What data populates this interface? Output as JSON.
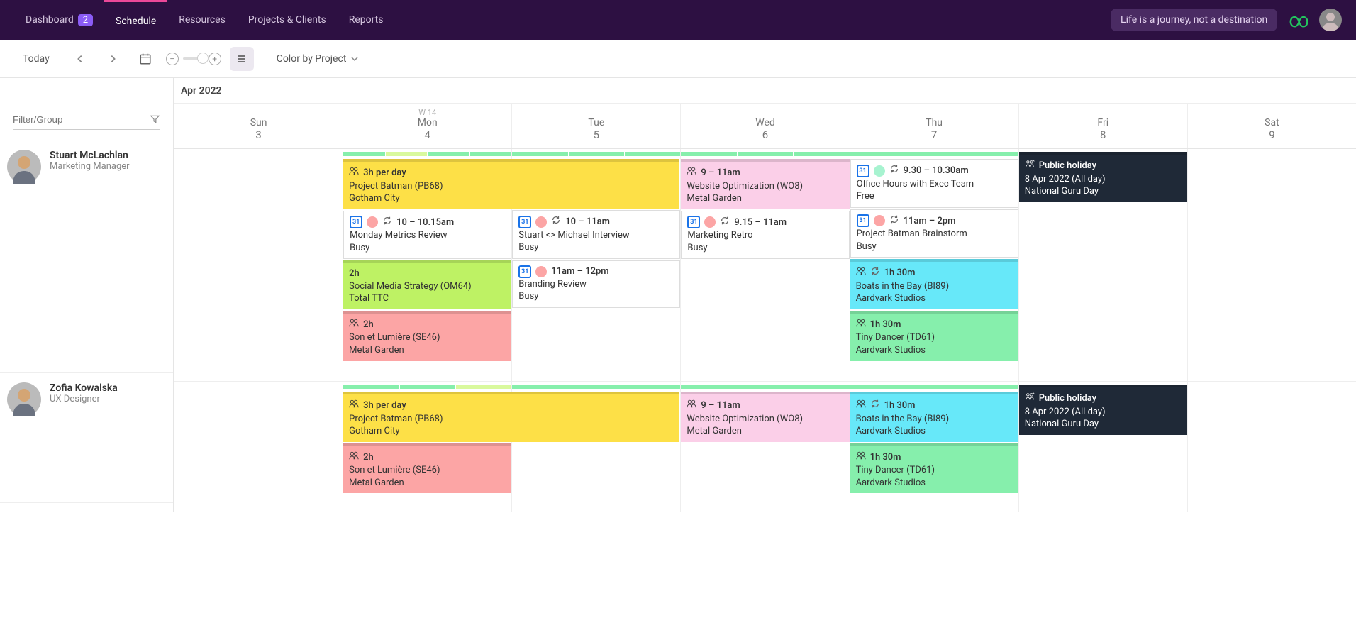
{
  "nav": {
    "items": [
      {
        "label": "Dashboard",
        "badge": "2"
      },
      {
        "label": "Schedule"
      },
      {
        "label": "Resources"
      },
      {
        "label": "Projects & Clients"
      },
      {
        "label": "Reports"
      }
    ],
    "quote": "Life is a journey, not a destination"
  },
  "toolbar": {
    "today": "Today",
    "colorby": "Color by Project",
    "month": "Apr 2022"
  },
  "filter": {
    "placeholder": "Filter/Group"
  },
  "days": [
    {
      "wk": "",
      "d": "Sun",
      "n": "3"
    },
    {
      "wk": "W 14",
      "d": "Mon",
      "n": "4"
    },
    {
      "wk": "",
      "d": "Tue",
      "n": "5"
    },
    {
      "wk": "",
      "d": "Wed",
      "n": "6"
    },
    {
      "wk": "",
      "d": "Thu",
      "n": "7"
    },
    {
      "wk": "",
      "d": "Fri",
      "n": "8"
    },
    {
      "wk": "",
      "d": "Sat",
      "n": "9"
    }
  ],
  "people": [
    {
      "name": "Stuart McLachlan",
      "role": "Marketing Manager"
    },
    {
      "name": "Zofia Kowalska",
      "role": "UX Designer"
    }
  ],
  "row1": {
    "mon": [
      {
        "cls": "c-yellow",
        "icon": "people",
        "dur": "3h per day",
        "title": "Project Batman (PB68)",
        "sub": "Gotham City",
        "spanto": "tue"
      },
      {
        "cls": "c-white",
        "gcal": true,
        "dot": "#fca5a5",
        "recur": true,
        "time": "10 – 10.15am",
        "title": "Monday Metrics Review",
        "sub": "Busy"
      },
      {
        "cls": "c-lime",
        "dur": "2h",
        "title": "Social Media Strategy (OM64)",
        "sub": "Total TTC"
      },
      {
        "cls": "c-salmon",
        "icon": "people",
        "dur": "2h",
        "title": "Son et Lumière (SE46)",
        "sub": "Metal Garden"
      }
    ],
    "tue": [
      {
        "cls": "c-white",
        "gcal": true,
        "dot": "#fca5a5",
        "recur": true,
        "time": "10 – 11am",
        "title": "Stuart <> Michael Interview",
        "sub": "Busy"
      },
      {
        "cls": "c-white",
        "gcal": true,
        "dot": "#fca5a5",
        "time": "11am – 12pm",
        "title": "Branding Review",
        "sub": "Busy"
      }
    ],
    "wed": [
      {
        "cls": "c-pink",
        "icon": "people",
        "dur": "9 – 11am",
        "title": "Website Optimization (WO8)",
        "sub": "Metal Garden"
      },
      {
        "cls": "c-white",
        "gcal": true,
        "dot": "#fca5a5",
        "recur": true,
        "time": "9.15 – 11am",
        "title": "Marketing Retro",
        "sub": "Busy"
      }
    ],
    "thu": [
      {
        "cls": "c-white",
        "gcal": true,
        "dot": "#a7f3d0",
        "recur": true,
        "time": "9.30 – 10.30am",
        "title": "Office Hours with Exec Team",
        "sub": "Free"
      },
      {
        "cls": "c-white",
        "gcal": true,
        "dot": "#fca5a5",
        "recur": true,
        "time": "11am – 2pm",
        "title": "Project Batman Brainstorm",
        "sub": "Busy"
      },
      {
        "cls": "c-cyan",
        "icon": "people",
        "recur": true,
        "dur": "1h 30m",
        "title": "Boats in the Bay (BI89)",
        "sub": "Aardvark Studios"
      },
      {
        "cls": "c-green",
        "icon": "people",
        "dur": "1h 30m",
        "title": "Tiny Dancer (TD61)",
        "sub": "Aardvark Studios"
      }
    ],
    "fri": [
      {
        "cls": "c-black",
        "icon": "holiday",
        "dur": "Public holiday",
        "title": "8 Apr 2022 (All day)",
        "sub": "National Guru Day"
      }
    ]
  },
  "row2": {
    "mon": [
      {
        "cls": "c-yellow",
        "icon": "people",
        "dur": "3h per day",
        "title": "Project Batman (PB68)",
        "sub": "Gotham City"
      },
      {
        "cls": "c-salmon",
        "icon": "people",
        "dur": "2h",
        "title": "Son et Lumière (SE46)",
        "sub": "Metal Garden"
      }
    ],
    "wed": [
      {
        "cls": "c-pink",
        "icon": "people",
        "dur": "9 – 11am",
        "title": "Website Optimization (WO8)",
        "sub": "Metal Garden"
      }
    ],
    "thu": [
      {
        "cls": "c-cyan",
        "icon": "people",
        "recur": true,
        "dur": "1h 30m",
        "title": "Boats in the Bay (BI89)",
        "sub": "Aardvark Studios"
      },
      {
        "cls": "c-green",
        "icon": "people",
        "dur": "1h 30m",
        "title": "Tiny Dancer (TD61)",
        "sub": "Aardvark Studios"
      }
    ],
    "fri": [
      {
        "cls": "c-black",
        "icon": "holiday",
        "dur": "Public holiday",
        "title": "8 Apr 2022 (All day)",
        "sub": "National Guru Day"
      }
    ]
  }
}
